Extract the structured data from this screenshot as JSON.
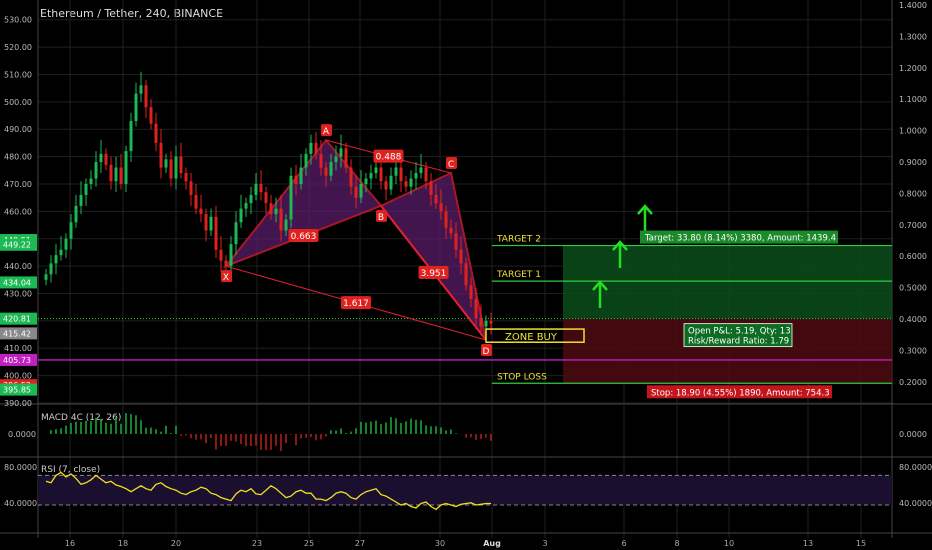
{
  "header": {
    "title": "Ethereum / Tether, 240, BINANCE"
  },
  "colors": {
    "background": "#000000",
    "grid": "#1f1f1f",
    "bull": "#1db954",
    "bear": "#e0221f",
    "pattern_line": "#e02030",
    "pattern_fill": "#5a1d6a",
    "target_zone": "#0a4d1a",
    "stop_zone": "#4d0a12",
    "macd_pos": "#19a33a",
    "macd_neg": "#b01d1d",
    "rsi_line": "#f0e020",
    "rsi_band": "#1a0f2e",
    "arrow": "#22dd22",
    "level_yellow": "#f0e030",
    "level_green": "#2ecc40"
  },
  "chart_data": [
    {
      "type": "candlestick",
      "name": "price",
      "y_axis_left": {
        "ticks": [
          "530.00",
          "520.00",
          "510.00",
          "500.00",
          "490.00",
          "480.00",
          "470.00",
          "460.00",
          "450.00",
          "440.00",
          "430.00",
          "420.00",
          "410.00",
          "400.00",
          "390.00"
        ],
        "ylim": [
          390,
          535
        ]
      },
      "y_axis_right": {
        "ticks": [
          "1.4000",
          "1.3000",
          "1.2000",
          "1.1000",
          "1.0000",
          "0.9000",
          "0.8000",
          "0.7000",
          "0.6000",
          "0.5000",
          "0.4000",
          "0.3000",
          "0.2000"
        ]
      },
      "x_ticks": [
        "16",
        "18",
        "20",
        "23",
        "25",
        "27",
        "30",
        "Aug",
        "3",
        "6",
        "8",
        "10",
        "13",
        "15"
      ],
      "price_badges": [
        {
          "label": "449.51",
          "value": 449.51,
          "color": "#1db954"
        },
        {
          "label": "449.22",
          "value": 447.8,
          "color": "#1db954"
        },
        {
          "label": "434.04",
          "value": 434.04,
          "color": "#1db954"
        },
        {
          "label": "420.81",
          "value": 420.81,
          "color": "#1db954"
        },
        {
          "label": "415.42",
          "value": 415.42,
          "color": "#888888"
        },
        {
          "label": "405.73",
          "value": 405.73,
          "color": "#c020c0"
        },
        {
          "label": "396.52",
          "value": 396.52,
          "color": "#e0221f"
        },
        {
          "label": "395.85",
          "value": 394.9,
          "color": "#1db954"
        }
      ],
      "close_path": [
        437,
        441,
        444,
        446,
        450,
        456,
        462,
        466,
        470,
        472,
        478,
        481,
        477,
        471,
        476,
        470,
        482,
        493,
        503,
        506,
        498,
        492,
        485,
        476,
        479,
        472,
        480,
        474,
        471,
        466,
        461,
        459,
        453,
        458,
        446,
        442,
        440,
        448,
        456,
        461,
        463,
        466,
        470,
        467,
        463,
        459,
        461,
        453,
        457,
        473,
        470,
        476,
        481,
        485,
        481,
        476,
        473,
        478,
        480,
        483,
        476,
        469,
        465,
        470,
        472,
        474,
        476,
        471,
        468,
        473,
        476,
        471,
        469,
        472,
        474,
        476,
        471,
        466,
        463,
        460,
        454,
        452,
        446,
        441,
        433,
        428,
        421,
        418,
        420,
        419
      ],
      "harmonic_points": {
        "X": {
          "label": "X",
          "i": 36,
          "price": 440
        },
        "A": {
          "label": "A",
          "i": 56,
          "price": 486
        },
        "B": {
          "label": "B",
          "i": 67,
          "price": 462
        },
        "C": {
          "label": "C",
          "i": 81,
          "price": 474
        },
        "D": {
          "label": "D",
          "i": 88,
          "price": 413
        }
      },
      "ratios": [
        {
          "label": "0.663",
          "between": [
            "X",
            "B"
          ]
        },
        {
          "label": "0.488",
          "between": [
            "A",
            "C"
          ]
        },
        {
          "label": "3.951",
          "between": [
            "B",
            "D"
          ]
        },
        {
          "label": "1.617",
          "between": [
            "X",
            "D"
          ]
        }
      ],
      "levels": [
        {
          "label": "TARGET 2",
          "price": 447.5
        },
        {
          "label": "TARGET 1",
          "price": 434.5
        },
        {
          "label": "STOP LOSS",
          "price": 397.2
        }
      ],
      "zone_buy": {
        "label": "ZONE BUY",
        "low": 412.2,
        "high": 417.0
      },
      "dotted_level": 420.81,
      "magenta_level": 405.73,
      "trade_box": {
        "entry": 420.81,
        "target": 447.5,
        "stop": 397.2,
        "target_text": "Target: 33.80 (8.14%) 3380, Amount: 1439.4",
        "stop_text": "Stop: 18.90 (4.55%) 1890, Amount: 754.3",
        "pnl_text": "Open P&L: 5.19, Qty: 13",
        "rr_text": "Risk/Reward Ratio: 1.79"
      }
    },
    {
      "type": "bar",
      "name": "MACD 4C (12, 26)",
      "y_ticks": [
        "0.0000"
      ],
      "right_ticks": [
        "0.0000"
      ]
    },
    {
      "type": "line",
      "name": "RSI (7, close)",
      "y_ticks": [
        "80.0000",
        "40.0000"
      ],
      "right_ticks": [
        "80.0000",
        "40.0000"
      ],
      "band": [
        30,
        70
      ],
      "values": [
        62,
        60,
        70,
        74,
        68,
        72,
        66,
        58,
        60,
        64,
        70,
        65,
        60,
        62,
        57,
        55,
        52,
        48,
        52,
        56,
        52,
        50,
        58,
        60,
        55,
        52,
        50,
        46,
        44,
        48,
        50,
        54,
        52,
        46,
        44,
        40,
        38,
        36,
        45,
        50,
        48,
        52,
        45,
        44,
        50,
        56,
        52,
        46,
        40,
        42,
        48,
        50,
        46,
        46,
        38,
        38,
        36,
        40,
        46,
        48,
        46,
        40,
        38,
        44,
        48,
        50,
        52,
        44,
        42,
        38,
        34,
        30,
        32,
        28,
        26,
        32,
        34,
        28,
        24,
        30,
        32,
        30,
        28,
        31,
        32,
        33,
        30,
        31,
        32,
        32
      ]
    }
  ]
}
